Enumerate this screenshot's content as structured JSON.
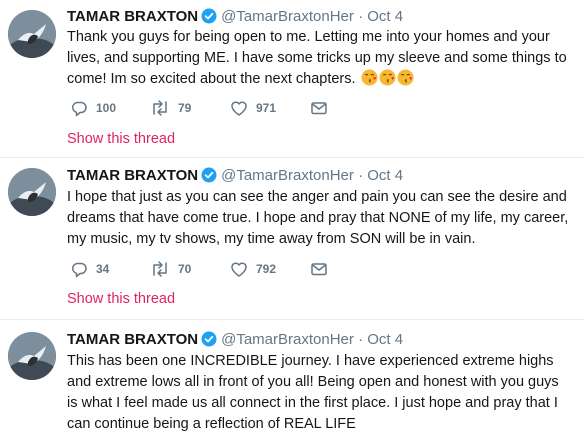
{
  "accent_color": "#e0245e",
  "muted_color": "#657786",
  "verified_color": "#1da1f2",
  "tweets": [
    {
      "name": "TAMAR BRAXTON",
      "handle": "@TamarBraxtonHer",
      "separator": "·",
      "date": "Oct 4",
      "text": "Thank you guys for being open to me. Letting me into your homes and your lives, and supporting ME. I have some tricks up my sleeve and some things to come! Im so excited about the next chapters.",
      "emojis": [
        "kissing-face-icon",
        "kissing-face-icon",
        "kissing-face-icon"
      ],
      "replies": "100",
      "retweets": "79",
      "likes": "971",
      "show_thread": "Show this thread"
    },
    {
      "name": "TAMAR BRAXTON",
      "handle": "@TamarBraxtonHer",
      "separator": "·",
      "date": "Oct 4",
      "text": "I hope that just as you can see the anger and pain you can see the desire and dreams that have come true. I hope and pray that NONE of my life, my career, my music, my tv shows, my time away from SON will be in vain.",
      "replies": "34",
      "retweets": "70",
      "likes": "792",
      "show_thread": "Show this thread"
    },
    {
      "name": "TAMAR BRAXTON",
      "handle": "@TamarBraxtonHer",
      "separator": "·",
      "date": "Oct 4",
      "text": "This has been one INCREDIBLE journey. I have experienced extreme highs and extreme lows all in front of you all! Being open and honest with you guys is what I feel made us all connect in the first place. I just hope and pray that I can continue being a reflection of REAL LIFE"
    }
  ]
}
